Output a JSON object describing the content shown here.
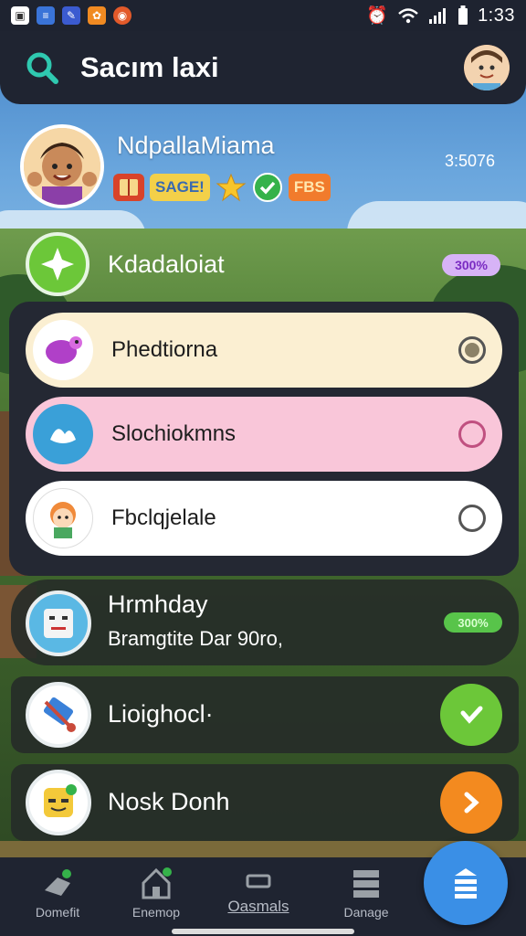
{
  "status_bar": {
    "time": "1:33",
    "app_icons": [
      "gallery-icon",
      "sheets-icon",
      "docs-icon",
      "orange-app-icon",
      "chrome-icon"
    ],
    "system_icons": [
      "alarm-icon",
      "wifi-icon",
      "signal-icon",
      "battery-icon"
    ]
  },
  "header": {
    "title": "Sacım laxi",
    "search_icon": "search-icon",
    "avatar": "user-avatar"
  },
  "profile": {
    "name": "NdpallaMiama",
    "score": "3:5076",
    "badges": [
      {
        "icon": "book-badge-icon"
      },
      {
        "label": "SAGE!",
        "color": "#f3d049"
      },
      {
        "icon": "star-icon",
        "color": "#f7c52b"
      },
      {
        "icon": "check-badge-icon",
        "color": "#35b24a"
      },
      {
        "label": "FBS",
        "color": "#f17b2c"
      }
    ]
  },
  "level": {
    "title": "Kdadaloiat",
    "pill": "300%",
    "pill_color": "#d7b3f6"
  },
  "options": [
    {
      "label": "Phedtiorna",
      "color": "#fbefd2",
      "selected": true,
      "icon": "purple-creature-icon"
    },
    {
      "label": "Slochiokmns",
      "color": "#f9c6d9",
      "selected": false,
      "icon": "blue-blob-icon"
    },
    {
      "label": "Fbclqjelale",
      "color": "#ffffff",
      "selected": false,
      "icon": "girl-avatar-icon"
    }
  ],
  "list": [
    {
      "title": "Hrmhday",
      "subtitle": "Bramgtite Dar 90ro,",
      "pill": "300%",
      "icon": "robot-icon"
    },
    {
      "title": "Lioighocl·",
      "action_color": "#6cc739",
      "icon": "tools-icon"
    },
    {
      "title": "Nosk Donh",
      "action_color": "#f38a1f",
      "icon": "yellow-face-icon"
    }
  ],
  "nav": [
    {
      "label": "Domefit",
      "icon": "watering-can-icon"
    },
    {
      "label": "Enemop",
      "icon": "house-icon"
    },
    {
      "label": "Oasmals",
      "icon": "ticket-icon"
    },
    {
      "label": "Danage",
      "icon": "stack-icon"
    }
  ],
  "fab": {
    "icon": "list-icon"
  }
}
